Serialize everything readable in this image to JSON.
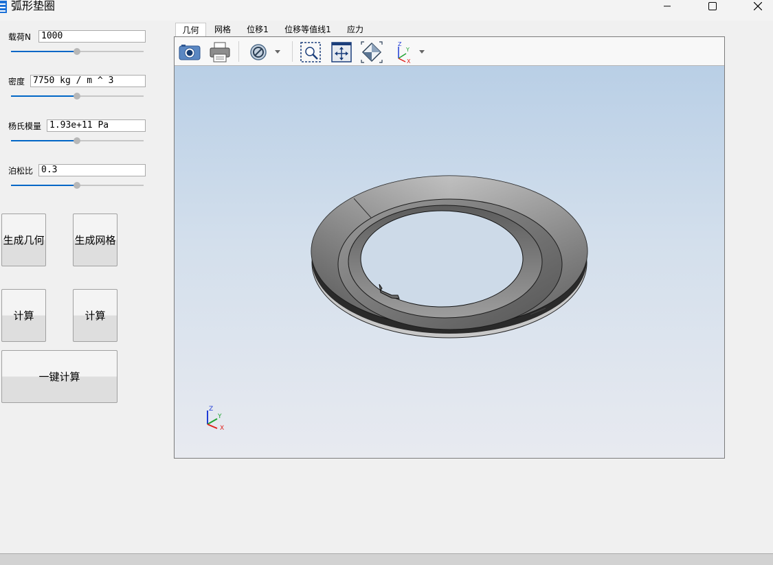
{
  "window": {
    "title": "弧形垫圈",
    "accent": "#1a6fd6"
  },
  "params": [
    {
      "label": "载荷N",
      "value": "1000",
      "slider_fraction": 0.5
    },
    {
      "label": "密度",
      "value": "7750 kg / m ^ 3",
      "slider_fraction": 0.5
    },
    {
      "label": "杨氏模量",
      "value": "1.93e+11 Pa",
      "slider_fraction": 0.5
    },
    {
      "label": "泊松比",
      "value": "0.3",
      "slider_fraction": 0.5
    }
  ],
  "buttons": {
    "gen_geometry": "生成几何",
    "gen_mesh": "生成网格",
    "compute_1": "计算",
    "compute_2": "计算",
    "one_click": "一键计算"
  },
  "tabs": [
    {
      "label": "几何",
      "active": true
    },
    {
      "label": "网格"
    },
    {
      "label": "位移1"
    },
    {
      "label": "位移等值线1"
    },
    {
      "label": "应力"
    }
  ],
  "toolbar_icons": [
    "camera-icon",
    "printer-icon",
    "hide-icon",
    "zoom-box-icon",
    "zoom-fit-icon",
    "view-orientation-icon",
    "axis-triad-icon"
  ],
  "axis_triad": {
    "x": "X",
    "y": "Y",
    "z": "Z"
  },
  "colors": {
    "x_axis": "#e0201b",
    "y_axis": "#1fa331",
    "z_axis": "#1f3ad6",
    "slider_fill": "#0066c6"
  }
}
